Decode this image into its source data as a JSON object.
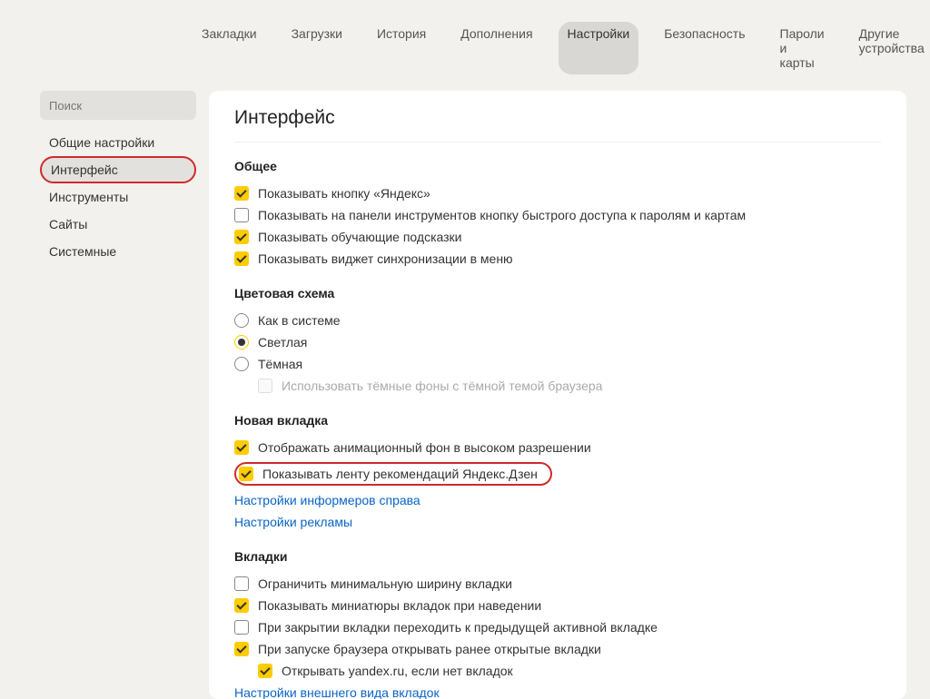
{
  "topnav": {
    "items": [
      {
        "label": "Закладки"
      },
      {
        "label": "Загрузки"
      },
      {
        "label": "История"
      },
      {
        "label": "Дополнения"
      },
      {
        "label": "Настройки"
      },
      {
        "label": "Безопасность"
      },
      {
        "label": "Пароли и карты"
      },
      {
        "label": "Другие устройства"
      }
    ],
    "active_index": 4
  },
  "sidebar": {
    "search_placeholder": "Поиск",
    "items": [
      {
        "label": "Общие настройки"
      },
      {
        "label": "Интерфейс"
      },
      {
        "label": "Инструменты"
      },
      {
        "label": "Сайты"
      },
      {
        "label": "Системные"
      }
    ],
    "active_index": 1
  },
  "page": {
    "title": "Интерфейс"
  },
  "general": {
    "title": "Общее",
    "opt_yandex_button": "Показывать кнопку «Яндекс»",
    "opt_passwords_button": "Показывать на панели инструментов кнопку быстрого доступа к паролям и картам",
    "opt_hints": "Показывать обучающие подсказки",
    "opt_sync_widget": "Показывать виджет синхронизации в меню"
  },
  "theme": {
    "title": "Цветовая схема",
    "opt_system": "Как в системе",
    "opt_light": "Светлая",
    "opt_dark": "Тёмная",
    "opt_dark_bg": "Использовать тёмные фоны с тёмной темой браузера"
  },
  "newtab": {
    "title": "Новая вкладка",
    "opt_anim_bg": "Отображать анимационный фон в высоком разрешении",
    "opt_zen": "Показывать ленту рекомендаций Яндекс.Дзен",
    "link_informers": "Настройки информеров справа",
    "link_ads": "Настройки рекламы"
  },
  "tabs": {
    "title": "Вкладки",
    "opt_min_width": "Ограничить минимальную ширину вкладки",
    "opt_thumbnails": "Показывать миниатюры вкладок при наведении",
    "opt_prev_active": "При закрытии вкладки переходить к предыдущей активной вкладке",
    "opt_restore": "При запуске браузера открывать ранее открытые вкладки",
    "opt_open_yandex": "Открывать yandex.ru, если нет вкладок",
    "link_appearance": "Настройки внешнего вида вкладок"
  }
}
